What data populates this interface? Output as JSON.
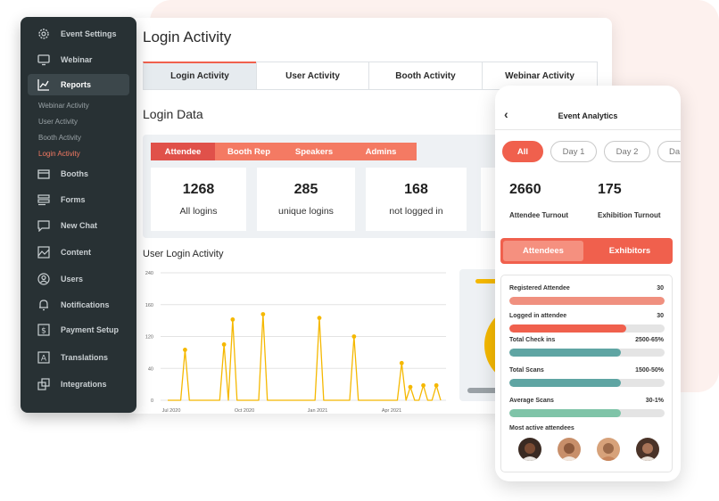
{
  "sidebar": {
    "items": [
      {
        "label": "Event Settings",
        "icon": "gear-icon"
      },
      {
        "label": "Webinar",
        "icon": "monitor-icon"
      },
      {
        "label": "Reports",
        "icon": "chart-icon"
      },
      {
        "label": "Booths",
        "icon": "booth-icon"
      },
      {
        "label": "Forms",
        "icon": "form-icon"
      },
      {
        "label": "New Chat",
        "icon": "chat-icon"
      },
      {
        "label": "Content",
        "icon": "image-icon"
      },
      {
        "label": "Users",
        "icon": "user-icon"
      },
      {
        "label": "Notifications",
        "icon": "bell-icon"
      },
      {
        "label": "Payment Setup",
        "icon": "dollar-icon"
      },
      {
        "label": "Translations",
        "icon": "translate-icon"
      },
      {
        "label": "Integrations",
        "icon": "integration-icon"
      }
    ],
    "active_item": "Reports",
    "sub_items": [
      "Webinar Activity",
      "User Activity",
      "Booth Activity",
      "Login Activity"
    ],
    "active_sub_item": "Login Activity"
  },
  "dashboard": {
    "title": "Login Activity",
    "tabs": [
      "Login Activity",
      "User Activity",
      "Booth Activity",
      "Webinar Activity"
    ],
    "active_tab": "Login Activity",
    "section_title": "Login Data",
    "role_tabs": [
      "Attendee",
      "Booth Rep",
      "Speakers",
      "Admins"
    ],
    "active_role_tab": "Attendee",
    "stats": [
      {
        "value": "1268",
        "label": "All logins"
      },
      {
        "value": "285",
        "label": "unique logins"
      },
      {
        "value": "168",
        "label": "not logged in"
      }
    ],
    "chart_title": "User Login Activity"
  },
  "chart_data": {
    "type": "line",
    "title": "User Login Activity",
    "xlabel": "",
    "ylabel": "",
    "yticks": [
      "0",
      "40",
      "120",
      "160",
      "240"
    ],
    "xticks": [
      "Jul 2020",
      "Oct 2020",
      "Jan 2021",
      "Apr 2021"
    ],
    "grid": true,
    "color": "#f5b800",
    "series": [
      {
        "values": [
          0,
          0,
          0,
          0,
          95,
          0,
          0,
          0,
          0,
          0,
          0,
          0,
          0,
          105,
          0,
          152,
          0,
          0,
          0,
          0,
          0,
          0,
          162,
          0,
          0,
          0,
          0,
          0,
          0,
          0,
          0,
          0,
          0,
          0,
          0,
          155,
          0,
          0,
          0,
          0,
          0,
          0,
          0,
          120,
          0,
          0,
          0,
          0,
          0,
          0,
          0,
          0,
          0,
          0,
          70,
          0,
          25,
          0,
          0,
          28,
          0,
          0,
          28,
          0
        ]
      }
    ]
  },
  "phone": {
    "title": "Event Analytics",
    "days": [
      "All",
      "Day 1",
      "Day 2",
      "Da"
    ],
    "active_day": "All",
    "stats": [
      {
        "value": "2660",
        "label": "Attendee Turnout"
      },
      {
        "value": "175",
        "label": "Exhibition Turnout"
      }
    ],
    "segments": [
      "Attendees",
      "Exhibitors"
    ],
    "active_segment": "Attendees",
    "metrics": [
      {
        "label": "Registered Attendee",
        "value": "30",
        "fill": 1.0,
        "color": "#f0907f"
      },
      {
        "label": "Logged in attendee",
        "value": "30",
        "fill": 0.75,
        "color": "#f0604d"
      },
      {
        "label": "Total Check ins",
        "value": "2500-65%",
        "fill": 0.72,
        "color": "#5fa5a3"
      },
      {
        "label": "Total Scans",
        "value": "1500-50%",
        "fill": 0.72,
        "color": "#5fa5a3"
      },
      {
        "label": "Average Scans",
        "value": "30-1%",
        "fill": 0.72,
        "color": "#7fc4a8"
      }
    ],
    "most_active_label": "Most active attendees"
  },
  "colors": {
    "accent": "#f0604d",
    "sidebar_bg": "#283134",
    "chart_line": "#f5b800"
  }
}
